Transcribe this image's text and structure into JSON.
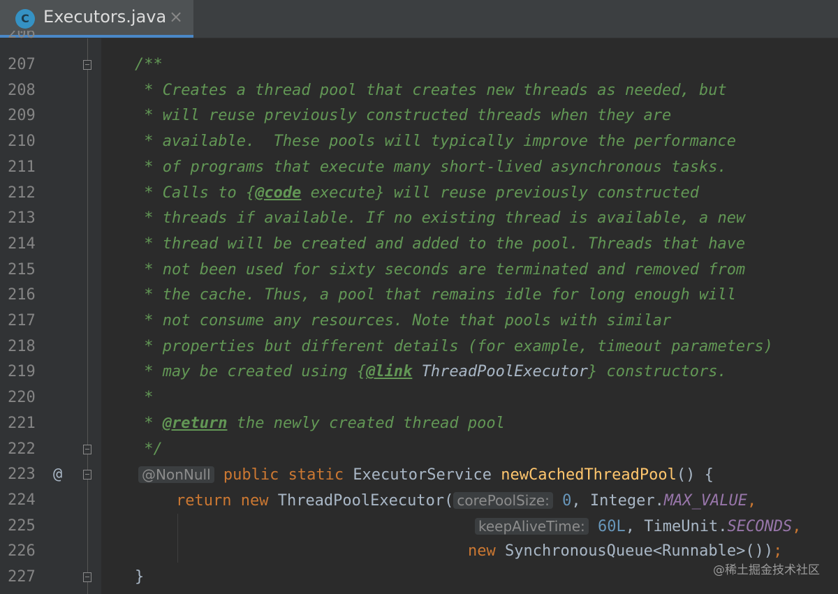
{
  "tab": {
    "icon_letter": "C",
    "title": "Executors.java",
    "close": "×"
  },
  "gutter": {
    "partial_line_number": "206",
    "override_marker": "@"
  },
  "lines": [
    {
      "n": "207",
      "parts": [
        {
          "t": "/**",
          "c": "doc"
        }
      ]
    },
    {
      "n": "208",
      "parts": [
        {
          "t": " * Creates a thread pool that creates new threads as needed, but",
          "c": "doc"
        }
      ]
    },
    {
      "n": "209",
      "parts": [
        {
          "t": " * will reuse previously constructed threads when they are",
          "c": "doc"
        }
      ]
    },
    {
      "n": "210",
      "parts": [
        {
          "t": " * available.  These pools will typically improve the performance",
          "c": "doc"
        }
      ]
    },
    {
      "n": "211",
      "parts": [
        {
          "t": " * of programs that execute many short-lived asynchronous tasks.",
          "c": "doc"
        }
      ]
    },
    {
      "n": "212",
      "parts": [
        {
          "t": " * Calls to {",
          "c": "doc"
        },
        {
          "t": "@code",
          "c": "doctag"
        },
        {
          "t": " execute} will reuse previously constructed",
          "c": "doc"
        }
      ]
    },
    {
      "n": "213",
      "parts": [
        {
          "t": " * threads if available. If no existing thread is available, a new",
          "c": "doc"
        }
      ]
    },
    {
      "n": "214",
      "parts": [
        {
          "t": " * thread will be created and added to the pool. Threads that have",
          "c": "doc"
        }
      ]
    },
    {
      "n": "215",
      "parts": [
        {
          "t": " * not been used for sixty seconds are terminated and removed from",
          "c": "doc"
        }
      ]
    },
    {
      "n": "216",
      "parts": [
        {
          "t": " * the cache. Thus, a pool that remains idle for long enough will",
          "c": "doc"
        }
      ]
    },
    {
      "n": "217",
      "parts": [
        {
          "t": " * not consume any resources. Note that pools with similar",
          "c": "doc"
        }
      ]
    },
    {
      "n": "218",
      "parts": [
        {
          "t": " * properties but different details (for example, timeout parameters)",
          "c": "doc"
        }
      ]
    },
    {
      "n": "219",
      "parts": [
        {
          "t": " * may be created using {",
          "c": "doc"
        },
        {
          "t": "@link",
          "c": "doctag"
        },
        {
          "t": " ThreadPoolExecutor",
          "c": "doclink"
        },
        {
          "t": "} constructors.",
          "c": "doc"
        }
      ]
    },
    {
      "n": "220",
      "parts": [
        {
          "t": " *",
          "c": "doc"
        }
      ]
    },
    {
      "n": "221",
      "parts": [
        {
          "t": " * ",
          "c": "doc"
        },
        {
          "t": "@return",
          "c": "doctag"
        },
        {
          "t": " the newly created thread pool",
          "c": "doc"
        }
      ]
    },
    {
      "n": "222",
      "parts": [
        {
          "t": " */",
          "c": "doc"
        }
      ]
    },
    {
      "n": "223",
      "parts": [
        {
          "t": "@NonNull",
          "c": "hint"
        },
        {
          "t": " ",
          "c": "plain"
        },
        {
          "t": "public static ",
          "c": "kw"
        },
        {
          "t": "ExecutorService ",
          "c": "plain"
        },
        {
          "t": "newCachedThreadPool",
          "c": "fn"
        },
        {
          "t": "() {",
          "c": "plain"
        }
      ]
    },
    {
      "n": "224",
      "parts": [
        {
          "t": "return new ",
          "c": "kw"
        },
        {
          "t": "ThreadPoolExecutor(",
          "c": "plain"
        },
        {
          "t": "corePoolSize:",
          "c": "hint"
        },
        {
          "t": " ",
          "c": "plain"
        },
        {
          "t": "0",
          "c": "num"
        },
        {
          "t": ", Integer.",
          "c": "plain"
        },
        {
          "t": "MAX_VALUE",
          "c": "static"
        },
        {
          "t": ",",
          "c": "kw"
        }
      ]
    },
    {
      "n": "225",
      "parts": [
        {
          "t": "keepAliveTime:",
          "c": "hint"
        },
        {
          "t": " ",
          "c": "plain"
        },
        {
          "t": "60L",
          "c": "num"
        },
        {
          "t": ", TimeUnit.",
          "c": "plain"
        },
        {
          "t": "SECONDS",
          "c": "static"
        },
        {
          "t": ",",
          "c": "kw"
        }
      ]
    },
    {
      "n": "226",
      "parts": [
        {
          "t": "new ",
          "c": "kw"
        },
        {
          "t": "SynchronousQueue<Runnable>())",
          "c": "plain"
        },
        {
          "t": ";",
          "c": "kw"
        }
      ]
    },
    {
      "n": "227",
      "parts": [
        {
          "t": "}",
          "c": "plain"
        }
      ]
    }
  ],
  "watermark": "@稀土掘金技术社区"
}
